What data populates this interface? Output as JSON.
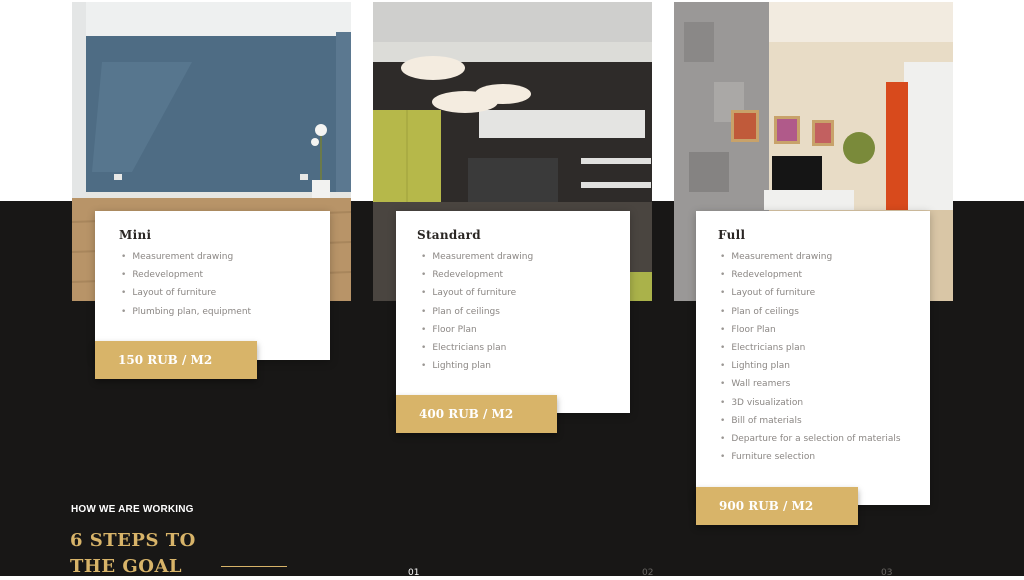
{
  "plans": [
    {
      "title": "Mini",
      "price": "150 RUB / M2",
      "features": [
        "Measurement drawing",
        "Redevelopment",
        "Layout of furniture",
        "Plumbing plan, equipment"
      ]
    },
    {
      "title": "Standard",
      "price": "400 RUB / M2",
      "features": [
        "Measurement drawing",
        "Redevelopment",
        "Layout of furniture",
        "Plan of ceilings",
        "Floor Plan",
        "Electricians plan",
        "Lighting plan"
      ]
    },
    {
      "title": "Full",
      "price": "900 RUB / M2",
      "features": [
        "Measurement drawing",
        "Redevelopment",
        "Layout of furniture",
        "Plan of ceilings",
        "Floor Plan",
        "Electricians plan",
        "Lighting plan",
        "Wall reamers",
        "3D visualization",
        "Bill of materials",
        "Departure for a selection of materials",
        "Furniture selection"
      ]
    }
  ],
  "steps_section": {
    "eyebrow": "HOW WE ARE WORKING",
    "title": "6 STEPS TO THE GOAL",
    "steps": [
      "01",
      "02",
      "03"
    ]
  },
  "colors": {
    "accent": "#d8b469",
    "dark_background": "#181716"
  }
}
